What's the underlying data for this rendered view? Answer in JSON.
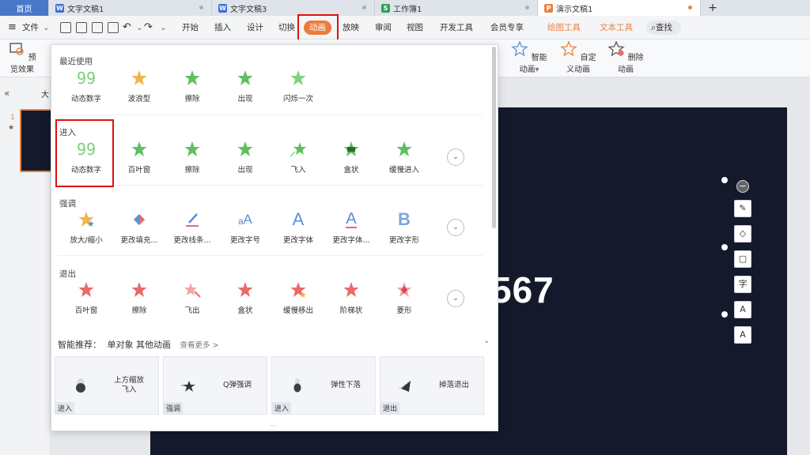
{
  "tabs": [
    {
      "label": "首页",
      "kind": "home"
    },
    {
      "label": "文字文稿1",
      "badge": "W",
      "badge_color": "#3b6fd6"
    },
    {
      "label": "文字文稿3",
      "badge": "W",
      "badge_color": "#3b6fd6"
    },
    {
      "label": "工作簿1",
      "badge": "S",
      "badge_color": "#2e9e5b"
    },
    {
      "label": "演示文稿1",
      "badge": "P",
      "badge_color": "#e8843f",
      "active": true
    }
  ],
  "new_tab": "+",
  "menu": {
    "hamburger": "≡",
    "file": "文件",
    "items": [
      "开始",
      "插入",
      "设计",
      "切换",
      "动画",
      "放映",
      "审阅",
      "视图",
      "开发工具",
      "会员专享",
      "绘图工具",
      "文本工具"
    ],
    "active": "动画",
    "search": "查找"
  },
  "ribbon": {
    "preview": "预览效果",
    "smart_anim": "智能动画",
    "custom_anim": "自定义动画",
    "delete_anim": "删除动画"
  },
  "left": {
    "collapse": "«",
    "outline_tab": "大",
    "slide_num": "1",
    "slide_mark": "★"
  },
  "slide": {
    "text": "567"
  },
  "dropdown": {
    "recent": {
      "title": "最近使用",
      "items": [
        "动态数字",
        "波浪型",
        "擦除",
        "出现",
        "闪烁一次"
      ]
    },
    "enter": {
      "title": "进入",
      "items": [
        "动态数字",
        "百叶窗",
        "擦除",
        "出现",
        "飞入",
        "盒状",
        "缓慢进入"
      ]
    },
    "emphasis": {
      "title": "强调",
      "items": [
        "放大/缩小",
        "更改填充...",
        "更改线条...",
        "更改字号",
        "更改字体",
        "更改字体...",
        "更改字形"
      ]
    },
    "exit": {
      "title": "退出",
      "items": [
        "百叶窗",
        "擦除",
        "飞出",
        "盒状",
        "缓慢移出",
        "阶梯状",
        "菱形"
      ]
    },
    "smart": {
      "title": "智能推荐：",
      "subtitle": "单对象 其他动画",
      "more": "查看更多 >",
      "cards": [
        {
          "label": "上方缩放\n飞入",
          "tag": "进入"
        },
        {
          "label": "Q弹强调",
          "tag": "强调"
        },
        {
          "label": "弹性下落",
          "tag": "进入"
        },
        {
          "label": "掉落退出",
          "tag": "退出"
        }
      ]
    },
    "bottom_dots": "···"
  },
  "colors": {
    "accent": "#ee7a3b",
    "highlight": "#e01010",
    "enter_green": "#5fbf5f",
    "exit_red": "#e86a6a",
    "emphasis_blue": "#5b8fd6"
  }
}
